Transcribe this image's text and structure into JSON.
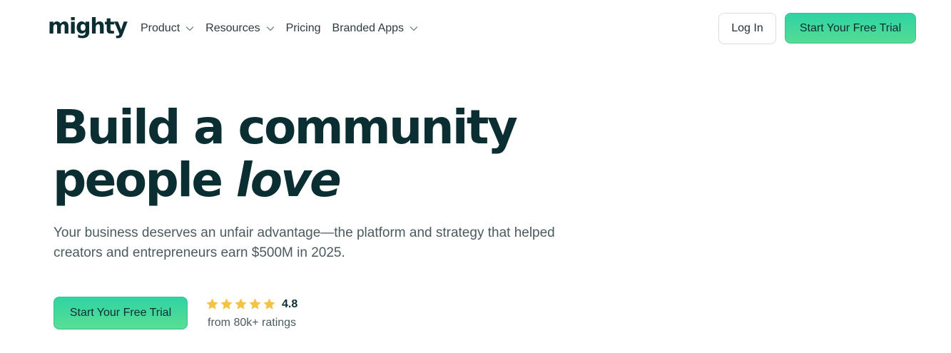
{
  "brand": {
    "logo_text": "mighty"
  },
  "nav": {
    "items": [
      {
        "label": "Product",
        "has_dropdown": true
      },
      {
        "label": "Resources",
        "has_dropdown": true
      },
      {
        "label": "Pricing",
        "has_dropdown": false
      },
      {
        "label": "Branded Apps",
        "has_dropdown": true
      }
    ],
    "login_label": "Log In",
    "trial_label": "Start Your Free Trial"
  },
  "hero": {
    "headline_line1": "Build a community",
    "headline_line2_plain": "people ",
    "headline_line2_em": "love",
    "subtext": "Your business deserves an unfair advantage—the platform and strategy that helped creators and entrepreneurs earn $500M in 2025.",
    "cta_label": "Start Your Free Trial",
    "rating": {
      "stars": 5,
      "score": "4.8",
      "count_text": "from 80k+ ratings"
    }
  },
  "colors": {
    "text_dark": "#0b2e33",
    "accent_green_top": "#2fd3a4",
    "accent_green_bottom": "#55dc93",
    "star": "#f6c244"
  },
  "icons": {
    "dropdown": "chevron-down-icon",
    "star": "star-icon"
  }
}
